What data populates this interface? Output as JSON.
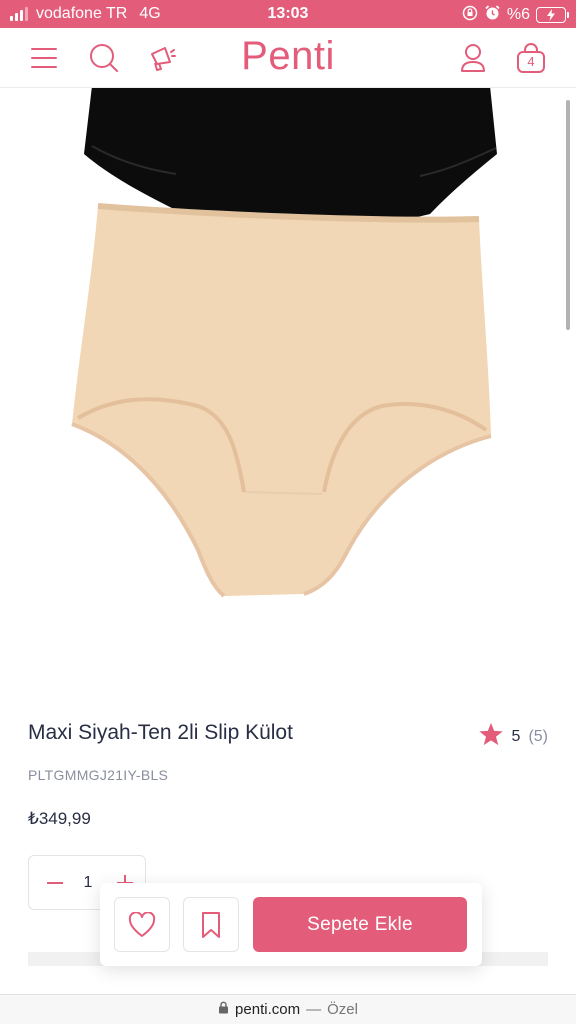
{
  "status_bar": {
    "carrier": "vodafone TR",
    "network": "4G",
    "time": "13:03",
    "battery": "%6"
  },
  "header": {
    "logo": "Penti",
    "cart_count": "4",
    "icons": [
      "menu-icon",
      "search-icon",
      "megaphone-icon",
      "user-icon",
      "cart-bag-icon"
    ]
  },
  "product": {
    "title": "Maxi Siyah-Ten 2li Slip Külot",
    "rating": "5",
    "rating_count": "(5)",
    "sku": "PLTGMMGJ21IY-BLS",
    "price": "₺349,99",
    "quantity": "1"
  },
  "actions": {
    "add_to_cart_label": "Sepete Ekle"
  },
  "browser": {
    "url": "penti.com",
    "separator": "—",
    "mode": "Özel"
  },
  "colors": {
    "brand": "#e35d7b",
    "text": "#2a2e45",
    "muted": "#8a8e9f"
  }
}
